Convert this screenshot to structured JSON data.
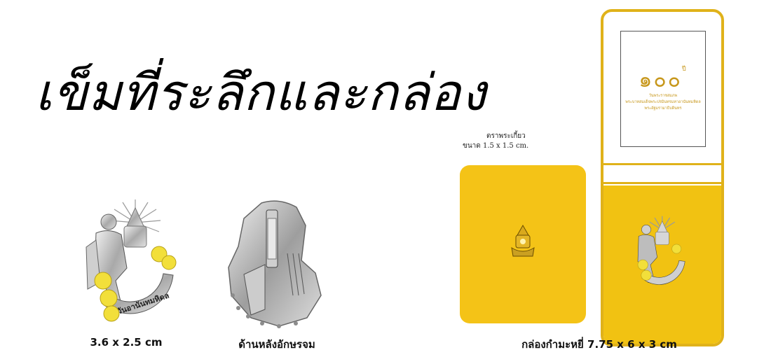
{
  "title": "เข็มที่ระลึกและกล่อง",
  "badge_front": {
    "caption": "3.6 x 2.5 cm"
  },
  "badge_back": {
    "caption": "ด้านหลังอักษรจม"
  },
  "seal_card": {
    "label_line1": "ตราพระเกี้ยว",
    "label_line2": "ขนาด 1.5 x 1.5 cm."
  },
  "box": {
    "caption": "กล่องกำมะหยี่ 7.75 x 6 x 3 cm",
    "lid_numeral": "๑๐๐",
    "lid_numeral_suffix": "ปี",
    "lid_text_line1": "วันพระราชสมภพ",
    "lid_text_line2": "พระบาทสมเด็จพระปรมินทรมหาอานันทมหิดล",
    "lid_text_line3": "พระอัฐมรามาธิบดินทร"
  },
  "colors": {
    "yellow": "#f4c317",
    "gold": "#c7971b",
    "silver": "#b8b8b8"
  }
}
